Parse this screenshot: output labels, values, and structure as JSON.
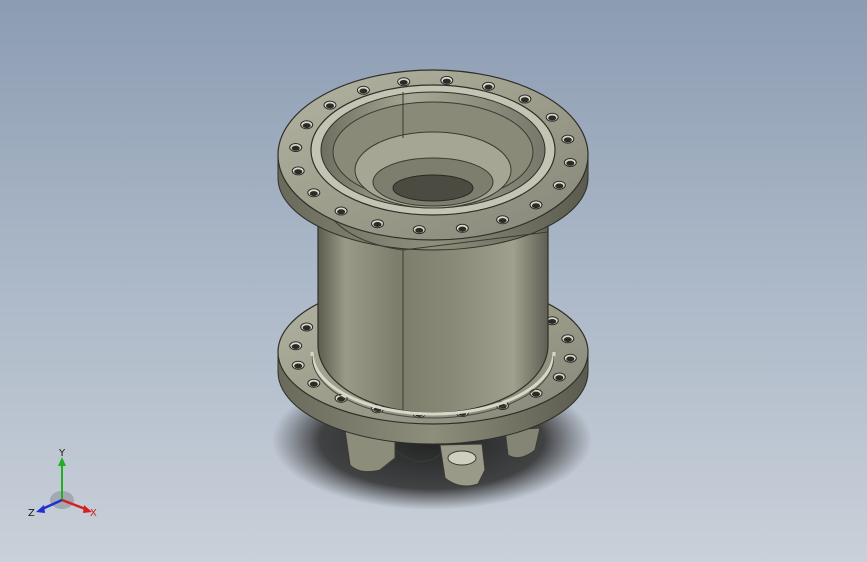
{
  "triad": {
    "x_label": "X",
    "y_label": "Y",
    "z_label": "Z",
    "x_color": "#d62020",
    "y_color": "#22b022",
    "z_color": "#2030d0"
  },
  "model": {
    "description_icon": "flange-hub-part-icon",
    "body_color": "#8f8f7f",
    "hole_color": "#2a2a26"
  }
}
